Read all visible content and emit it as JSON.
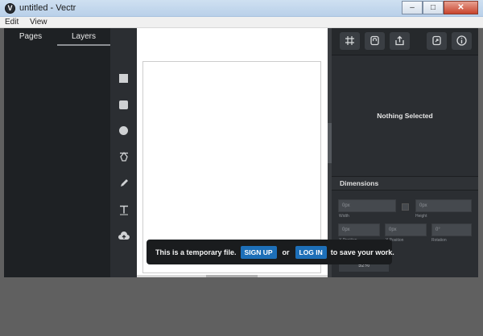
{
  "window": {
    "title": "untitled - Vectr",
    "app_icon_glyph": "V",
    "controls": {
      "minimize": "‒",
      "maximize": "□",
      "close": "✕"
    }
  },
  "menu": {
    "items": [
      "Edit",
      "View"
    ]
  },
  "left_panel": {
    "tabs": [
      "Pages",
      "Layers"
    ],
    "active_tab": "Layers"
  },
  "tools": [
    "square-tool",
    "rounded-square-tool",
    "circle-tool",
    "pen-tool",
    "pencil-tool",
    "text-tool",
    "import-tool"
  ],
  "right_panel": {
    "toolbar": [
      "grid-icon",
      "snap-icon",
      "export-icon",
      "share-icon",
      "info-icon"
    ],
    "empty_state": "Nothing Selected",
    "dimensions": {
      "header": "Dimensions",
      "width": {
        "value": "0px",
        "label": "Width"
      },
      "height": {
        "value": "0px",
        "label": "Height"
      },
      "x_position": {
        "value": "0px",
        "label": "X Position"
      },
      "y_position": {
        "value": "0px",
        "label": "Y Position"
      },
      "rotation": {
        "value": "0°",
        "label": "Rotation"
      }
    },
    "zoom": "92%"
  },
  "toast": {
    "message": "This is a temporary file.",
    "signup_label": "SIGN UP",
    "or_text": "or",
    "login_label": "LOG IN",
    "suffix": "to save your work."
  },
  "colors": {
    "accent": "#1d6fb8",
    "panel_dark": "#1e2124",
    "toolbar": "#2b2e32"
  }
}
